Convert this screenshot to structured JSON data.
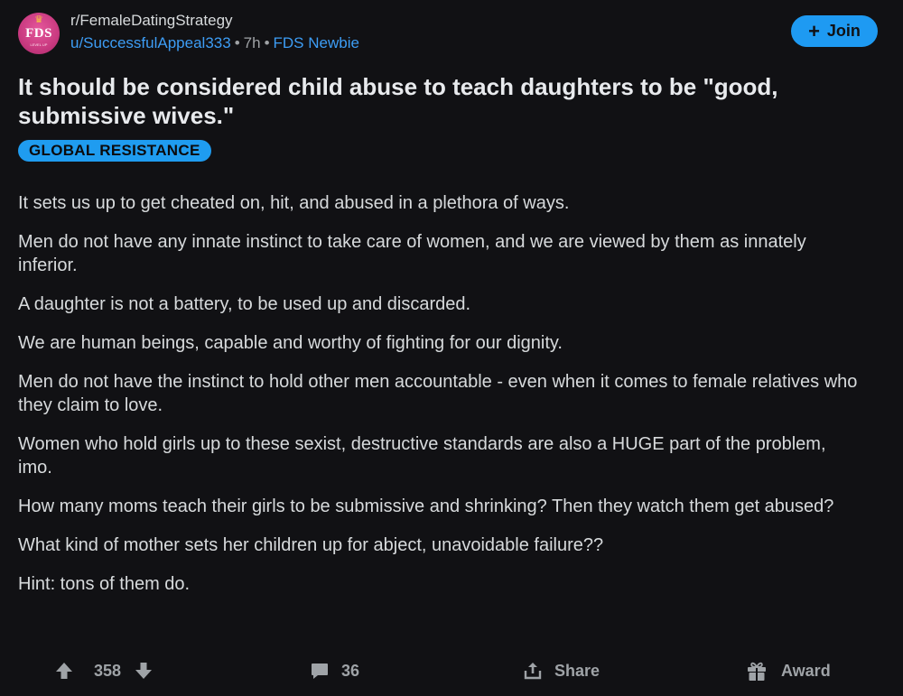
{
  "post": {
    "avatar_text": "FDS",
    "avatar_subtext": "LEVEL UP",
    "subreddit": "r/FemaleDatingStrategy",
    "author": "u/SuccessfulAppeal333",
    "separator": "•",
    "time": "7h",
    "user_flair": "FDS Newbie",
    "join_label": "Join",
    "title": "It should be considered child abuse to teach daughters to be \"good, submissive wives.\"",
    "post_flair": "GLOBAL RESISTANCE",
    "paragraphs": [
      "It sets us up to get cheated on, hit, and abused in a plethora of ways.",
      "Men do not have any innate instinct to take care of women, and we are viewed by them as innately inferior.",
      "A daughter is not a battery, to be used up and discarded.",
      "We are human beings, capable and worthy of fighting for our dignity.",
      "Men do not have the instinct to hold other men accountable - even when it comes to female relatives who they claim to love.",
      "Women who hold girls up to these sexist, destructive standards are also a HUGE part of the problem, imo.",
      "How many moms teach their girls to be submissive and shrinking? Then they watch them get abused?",
      "What kind of mother sets her children up for abject, unavoidable failure??",
      "Hint: tons of them do."
    ]
  },
  "actions": {
    "score": "358",
    "comments": "36",
    "share_label": "Share",
    "award_label": "Award"
  },
  "icons": {
    "upvote": "upvote-arrow-icon",
    "downvote": "downvote-arrow-icon",
    "comment": "comment-bubble-icon",
    "share": "share-icon",
    "award": "gift-award-icon",
    "join": "plus-icon"
  },
  "colors": {
    "background": "#111114",
    "accent": "#1e9af2",
    "link": "#3d9df5",
    "text": "#d7dadc",
    "muted": "#9fa3a7"
  }
}
